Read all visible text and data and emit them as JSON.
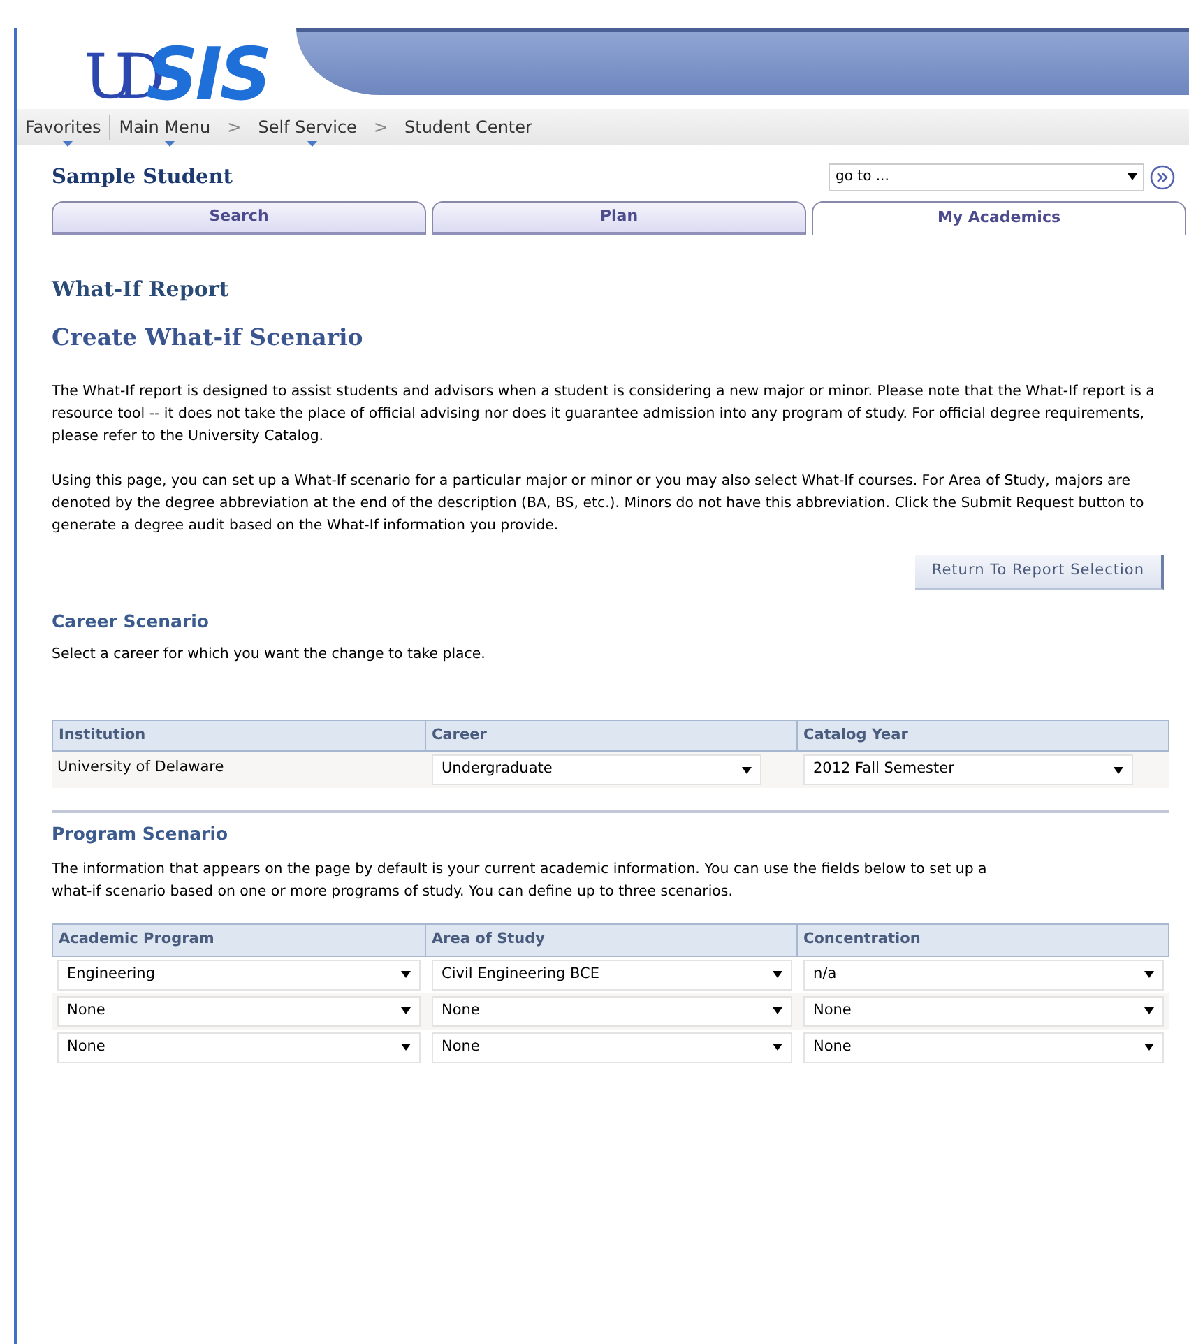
{
  "logo": {
    "prefix": "UD",
    "name": "SIS"
  },
  "breadcrumbs": [
    {
      "label": "Favorites",
      "kind": "menu"
    },
    {
      "label": "Main Menu",
      "kind": "menu"
    },
    {
      "label": ">",
      "kind": "separator"
    },
    {
      "label": "Self Service",
      "kind": "menu"
    },
    {
      "label": ">",
      "kind": "separator"
    },
    {
      "label": "Student Center",
      "kind": "page"
    }
  ],
  "student_name": "Sample Student",
  "goto": {
    "value": "go to ..."
  },
  "tabs": [
    {
      "label": "Search",
      "selected": false
    },
    {
      "label": "Plan",
      "selected": false
    },
    {
      "label": "My Academics",
      "selected": true
    }
  ],
  "page_title": "What-If Report",
  "section_title": "Create What-if Scenario",
  "paragraphs": [
    "The What-If report is designed to assist students and advisors when a student is considering a new major or minor.  Please note that the What-If report is a resource tool -- it does not take the place of official advising nor does it guarantee admission into any program of study. For official degree requirements, please refer to the University Catalog.",
    "Using this page, you can set up a What-If scenario for a particular major or minor or you may also select What-If courses.  For Area of Study, majors are denoted by the degree abbreviation at the end of the description (BA, BS, etc.). Minors do not have this abbreviation.  Click the Submit Request button to generate a degree audit based on the What-If information you provide."
  ],
  "return_button": "Return To Report Selection",
  "career_scenario": {
    "title": "Career Scenario",
    "text": "Select a career for which you want the change to take place.",
    "columns": [
      "Institution",
      "Career",
      "Catalog Year"
    ],
    "row": [
      {
        "kind": "text",
        "value": "University of Delaware"
      },
      {
        "kind": "dropdown",
        "value": "Undergraduate"
      },
      {
        "kind": "dropdown",
        "value": "2012 Fall Semester"
      }
    ]
  },
  "program_scenario": {
    "title": "Program Scenario",
    "text": "The information that appears on the page by default is your current academic information. You can use the fields below to set up a what-if scenario based on one or more programs of study. You can define up to three scenarios.",
    "columns": [
      "Academic Program",
      "Area of Study",
      "Concentration"
    ],
    "rows": [
      [
        "Engineering",
        "Civil Engineering BCE",
        "n/a"
      ],
      [
        "None",
        "None",
        "None"
      ],
      [
        "None",
        "None",
        "None"
      ]
    ]
  }
}
